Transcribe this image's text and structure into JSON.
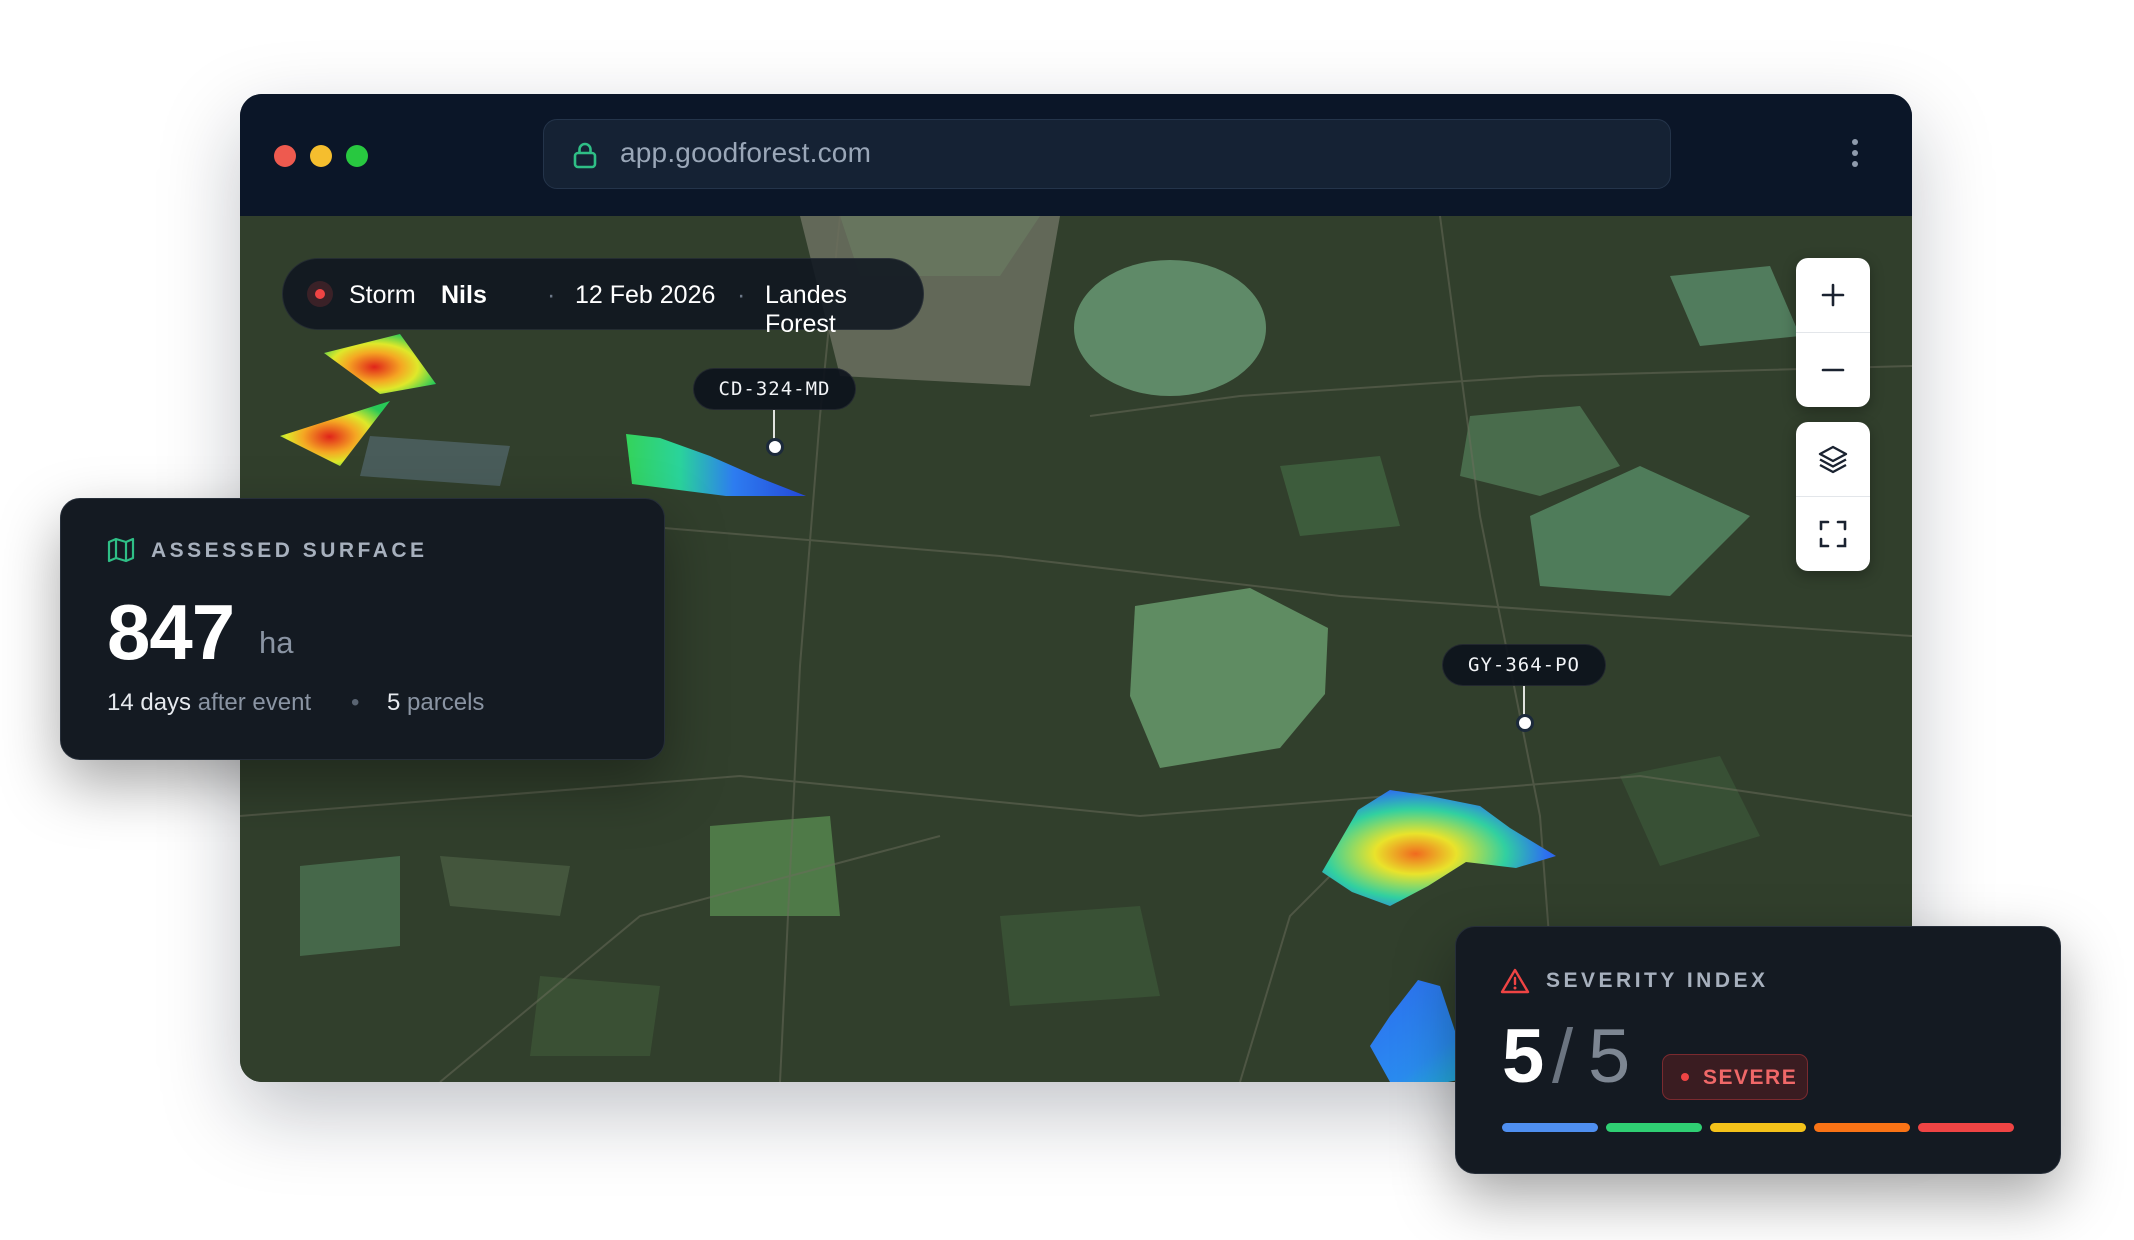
{
  "browser": {
    "url": "app.goodforest.com"
  },
  "event": {
    "type": "Storm",
    "name": "Nils",
    "date": "12 Feb 2026",
    "location": "Landes Forest",
    "separator": "·"
  },
  "parcels": [
    {
      "id": "CD-324-MD"
    },
    {
      "id": "GY-364-PO"
    }
  ],
  "map_controls": [
    "plus-icon",
    "minus-icon",
    "layers-icon",
    "fullscreen-icon"
  ],
  "assessed_surface": {
    "label": "ASSESSED SURFACE",
    "value": "847",
    "unit": "ha",
    "days": "14 days",
    "days_suffix": "after event",
    "separator": "•",
    "parcels_count": "5",
    "parcels_suffix": "parcels"
  },
  "severity": {
    "label": "SEVERITY INDEX",
    "score": "5",
    "slash": "/",
    "max": "5",
    "badge": "SEVERE",
    "scale_colors": [
      "#4f8ff0",
      "#2fcf73",
      "#f4c21a",
      "#f97316",
      "#ef4444"
    ]
  },
  "colors": {
    "accent_green": "#2fbf86",
    "danger": "#ef4444"
  }
}
